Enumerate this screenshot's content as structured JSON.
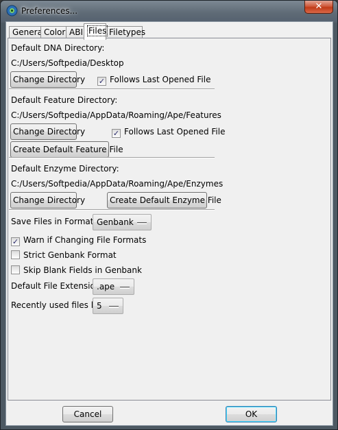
{
  "window": {
    "title": "Preferences...",
    "close_glyph": "✕",
    "app_icon": "ape-app-icon"
  },
  "tabs": [
    {
      "label": "General",
      "active": false
    },
    {
      "label": "Color",
      "active": false
    },
    {
      "label": "ABI",
      "active": false
    },
    {
      "label": "Files",
      "active": true
    },
    {
      "label": "Filetypes",
      "active": false
    }
  ],
  "files": {
    "dna": {
      "label": "Default DNA Directory:",
      "path": "C:/Users/Softpedia/Desktop",
      "change_button": "Change Directory",
      "follows_checkbox": {
        "label": "Follows Last Opened File",
        "checked": true
      }
    },
    "feature": {
      "label": "Default Feature Directory:",
      "path": "C:/Users/Softpedia/AppData/Roaming/Ape/Features",
      "change_button": "Change Directory",
      "follows_checkbox": {
        "label": "Follows Last Opened File",
        "checked": true
      },
      "create_button": "Create Default Feature File"
    },
    "enzyme": {
      "label": "Default Enzyme Directory:",
      "path": "C:/Users/Softpedia/AppData/Roaming/Ape/Enzymes",
      "change_button": "Change Directory",
      "create_button": "Create Default Enzyme File"
    },
    "save_format": {
      "label": "Save Files in Format:",
      "value": "Genbank"
    },
    "warn_changing": {
      "label": "Warn if Changing File Formats",
      "checked": true
    },
    "strict_genbank": {
      "label": "Strict Genbank Format",
      "checked": false
    },
    "skip_blank": {
      "label": "Skip Blank Fields in Genbank",
      "checked": false
    },
    "default_ext": {
      "label": "Default File Extension",
      "value": ".ape"
    },
    "recent_list": {
      "label": "Recently used files list",
      "value": "5"
    }
  },
  "footer": {
    "cancel": "Cancel",
    "ok": "OK"
  },
  "check_glyph": "✓",
  "colors": {
    "close_red": "#c13a17",
    "default_button_border": "#3c7fb1"
  }
}
